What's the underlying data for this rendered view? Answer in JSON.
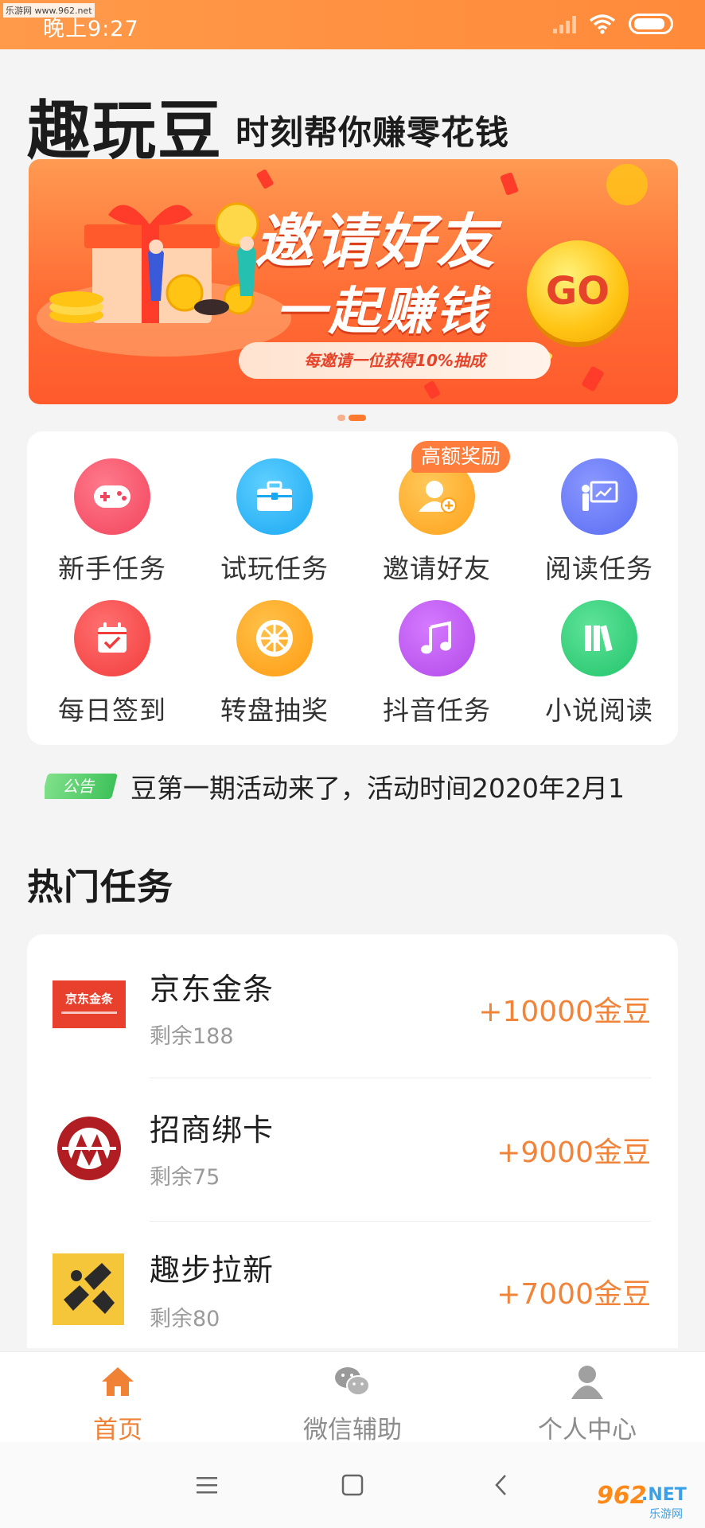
{
  "status_bar": {
    "time": "晚上9:27"
  },
  "watermark_top": "乐游网 www.962.net",
  "header": {
    "title": "趣玩豆",
    "slogan": "时刻帮你赚零花钱"
  },
  "banner": {
    "main_text": "邀请好友",
    "sub_text": "一起赚钱",
    "pill_text": "每邀请一位获得10%抽成",
    "go_text": "GO"
  },
  "grid": {
    "badge": "高额奖励",
    "items": [
      {
        "label": "新手任务",
        "icon": "gamepad-icon",
        "color": "#f2445c"
      },
      {
        "label": "试玩任务",
        "icon": "briefcase-icon",
        "color": "#1aa7f2"
      },
      {
        "label": "邀请好友",
        "icon": "add-user-icon",
        "color": "#ffa21a"
      },
      {
        "label": "阅读任务",
        "icon": "presentation-icon",
        "color": "#5a6cf2"
      },
      {
        "label": "每日签到",
        "icon": "calendar-check-icon",
        "color": "#f23c3c"
      },
      {
        "label": "转盘抽奖",
        "icon": "wheel-icon",
        "color": "#ff9a12"
      },
      {
        "label": "抖音任务",
        "icon": "music-note-icon",
        "color": "#b14ae8"
      },
      {
        "label": "小说阅读",
        "icon": "books-icon",
        "color": "#22c46a"
      }
    ]
  },
  "notice": {
    "tag": "公告",
    "text": "豆第一期活动来了，活动时间2020年2月1"
  },
  "hot_tasks": {
    "title": "热门任务",
    "items": [
      {
        "name": "京东金条",
        "remain": "剩余188",
        "reward": "+10000金豆",
        "logo": "jd-jintiao-logo",
        "logo_text": "京东金条"
      },
      {
        "name": "招商绑卡",
        "remain": "剩余75",
        "reward": "+9000金豆",
        "logo": "cmb-logo"
      },
      {
        "name": "趣步拉新",
        "remain": "剩余80",
        "reward": "+7000金豆",
        "logo": "qubu-logo"
      }
    ]
  },
  "bottom_nav": {
    "items": [
      {
        "label": "首页",
        "icon": "home-icon",
        "active": true
      },
      {
        "label": "微信辅助",
        "icon": "wechat-icon",
        "active": false
      },
      {
        "label": "个人中心",
        "icon": "person-icon",
        "active": false
      }
    ]
  },
  "watermark_bottom": {
    "number": "962",
    "suffix": ".NET",
    "cn": "乐游网"
  },
  "colors": {
    "accent": "#f08236",
    "status_bar": "#ff9a4a",
    "reward": "#f0843a"
  }
}
